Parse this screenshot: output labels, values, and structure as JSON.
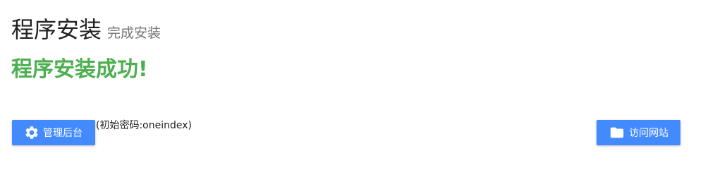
{
  "header": {
    "title": "程序安装",
    "subtitle": "完成安装"
  },
  "message": {
    "success": "程序安装成功!",
    "color": "#4caf50"
  },
  "actions": {
    "admin_label": "管理后台",
    "admin_icon": "gear-icon",
    "password_note": "(初始密码:oneindex)",
    "visit_label": "访问网站",
    "visit_icon": "folder-icon",
    "button_color": "#448aff"
  }
}
